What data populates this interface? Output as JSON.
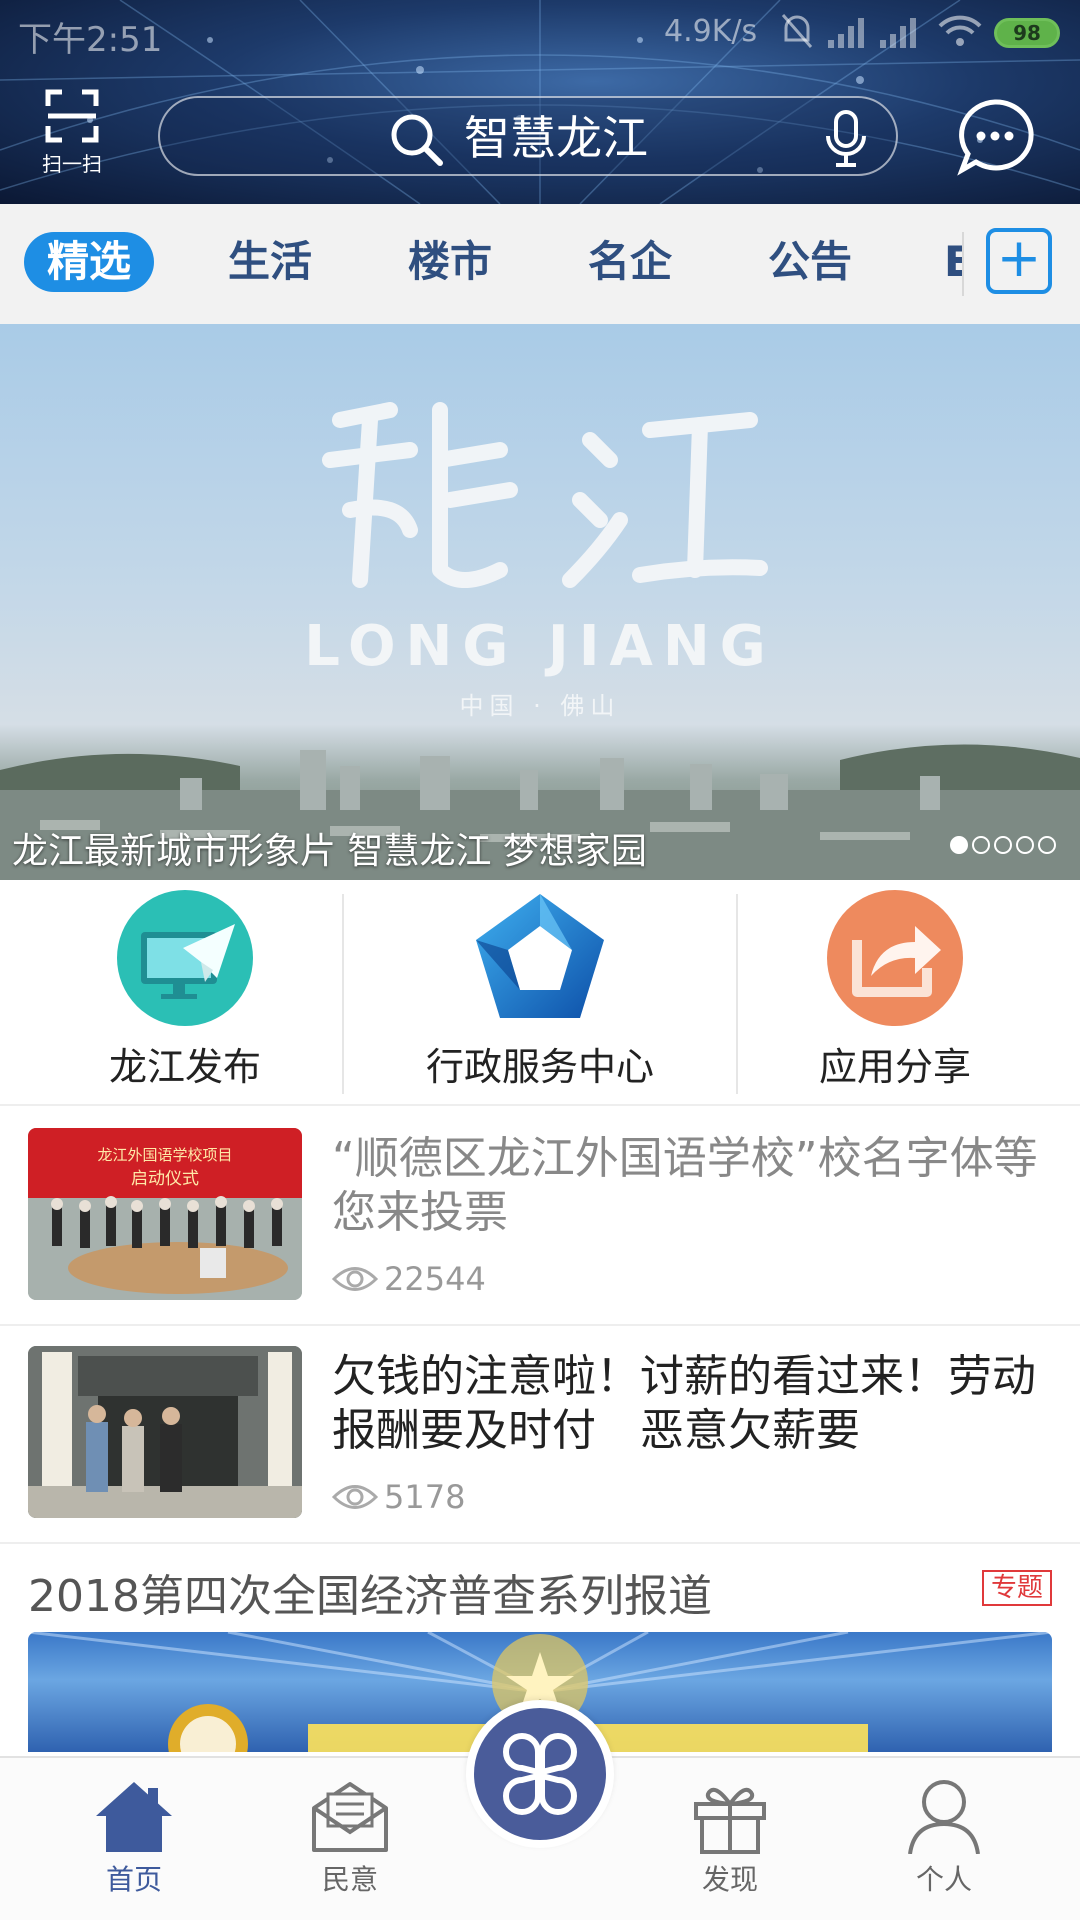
{
  "status_bar": {
    "time": "下午2:51",
    "network_speed": "4.9K/s",
    "battery": "98"
  },
  "header": {
    "scan_label": "扫一扫",
    "search_text": "智慧龙江"
  },
  "tabs": [
    {
      "label": "精选",
      "active": true
    },
    {
      "label": "生活",
      "active": false
    },
    {
      "label": "楼市",
      "active": false
    },
    {
      "label": "名企",
      "active": false
    },
    {
      "label": "公告",
      "active": false
    },
    {
      "label": "E",
      "active": false
    }
  ],
  "banner": {
    "art_title": "龍江",
    "title_en": "LONG JIANG",
    "subtitle": "中国 · 佛山",
    "caption": "龙江最新城市形象片 智慧龙江 梦想家园",
    "slide_count": 5,
    "active_slide": 1
  },
  "quick_services": [
    {
      "label": "龙江发布",
      "icon": "paper-plane-monitor-icon",
      "color": "#2bbfb5"
    },
    {
      "label": "行政服务中心",
      "icon": "pentagon-logo-icon",
      "color": "#1a73c9"
    },
    {
      "label": "应用分享",
      "icon": "share-icon",
      "color": "#ee8a5e"
    }
  ],
  "news": [
    {
      "title": "“顺德区龙江外国语学校”校名字体等您来投票",
      "views": "22544",
      "thumb_text_1": "龙江外国语学校项目",
      "thumb_text_2": "启动仪式",
      "read": true
    },
    {
      "title": "欠钱的注意啦！讨薪的看过来！劳动报酬要及时付　恶意欠薪要",
      "views": "5178",
      "read": false
    }
  ],
  "topic": {
    "title": "2018第四次全国经济普查系列报道",
    "badge": "专题"
  },
  "bottom_nav": [
    {
      "label": "首页",
      "icon": "home-icon",
      "active": true
    },
    {
      "label": "民意",
      "icon": "mail-icon",
      "active": false
    },
    {
      "label": "",
      "icon": "clover-icon",
      "active": false
    },
    {
      "label": "发现",
      "icon": "gift-icon",
      "active": false
    },
    {
      "label": "个人",
      "icon": "person-icon",
      "active": false
    }
  ],
  "colors": {
    "accent": "#1e8ee4",
    "tab_text": "#2f4f80",
    "nav_active": "#3e5a9c",
    "badge": "#e0393b"
  }
}
